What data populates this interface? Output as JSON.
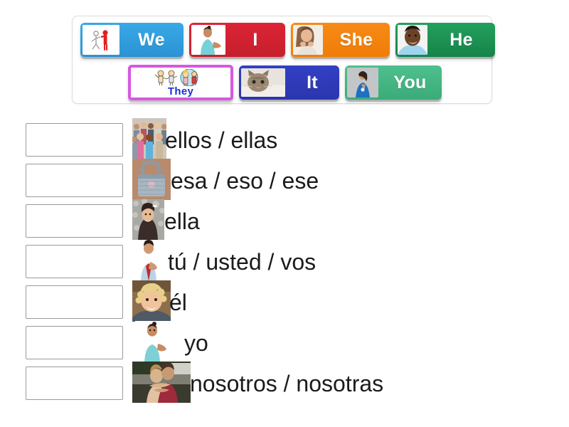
{
  "activity": {
    "type": "match-up-drag-and-drop",
    "language_pair": "English to Spanish subject pronouns"
  },
  "tray": {
    "rows": [
      [
        {
          "label": "We",
          "color": "#2d9fe0",
          "text_color": "#ffffff",
          "thumb": "stick-figures-icon"
        },
        {
          "label": "I",
          "color": "#d32231",
          "text_color": "#ffffff",
          "thumb": "girl-pointing-self-photo"
        },
        {
          "label": "She",
          "color": "#f2800c",
          "text_color": "#ffffff",
          "thumb": "girl-chin-on-hands-photo"
        },
        {
          "label": "He",
          "color": "#1a9152",
          "text_color": "#ffffff",
          "thumb": "smiling-boy-photo"
        }
      ],
      [
        {
          "label": "They",
          "color": "#ffffff",
          "border_color": "#d857e0",
          "text_color": "#1b2fd8",
          "thumb": "cartoon-children-icon"
        },
        {
          "label": "It",
          "color": "#2f3abb",
          "text_color": "#ffffff",
          "thumb": "tabby-cat-photo"
        },
        {
          "label": "You",
          "color": "#43b684",
          "text_color": "#ffffff",
          "thumb": "woman-pointing-photo"
        }
      ]
    ]
  },
  "answers": [
    {
      "text": "ellos / ellas",
      "picture": "crowd-of-people-photo",
      "dropbox_value": ""
    },
    {
      "text": "esa / eso / ese",
      "picture": "denim-handbag-photo",
      "dropbox_value": ""
    },
    {
      "text": "ella",
      "picture": "girl-dark-hair-photo",
      "dropbox_value": ""
    },
    {
      "text": "tú / usted / vos",
      "picture": "man-red-tie-pointing-photo",
      "dropbox_value": ""
    },
    {
      "text": "él",
      "picture": "blonde-curly-boy-photo",
      "dropbox_value": ""
    },
    {
      "text": "yo",
      "picture": "girl-teal-shirt-photo",
      "dropbox_value": ""
    },
    {
      "text": "nosotros / nosotras",
      "picture": "two-people-hugging-photo",
      "dropbox_value": ""
    }
  ]
}
